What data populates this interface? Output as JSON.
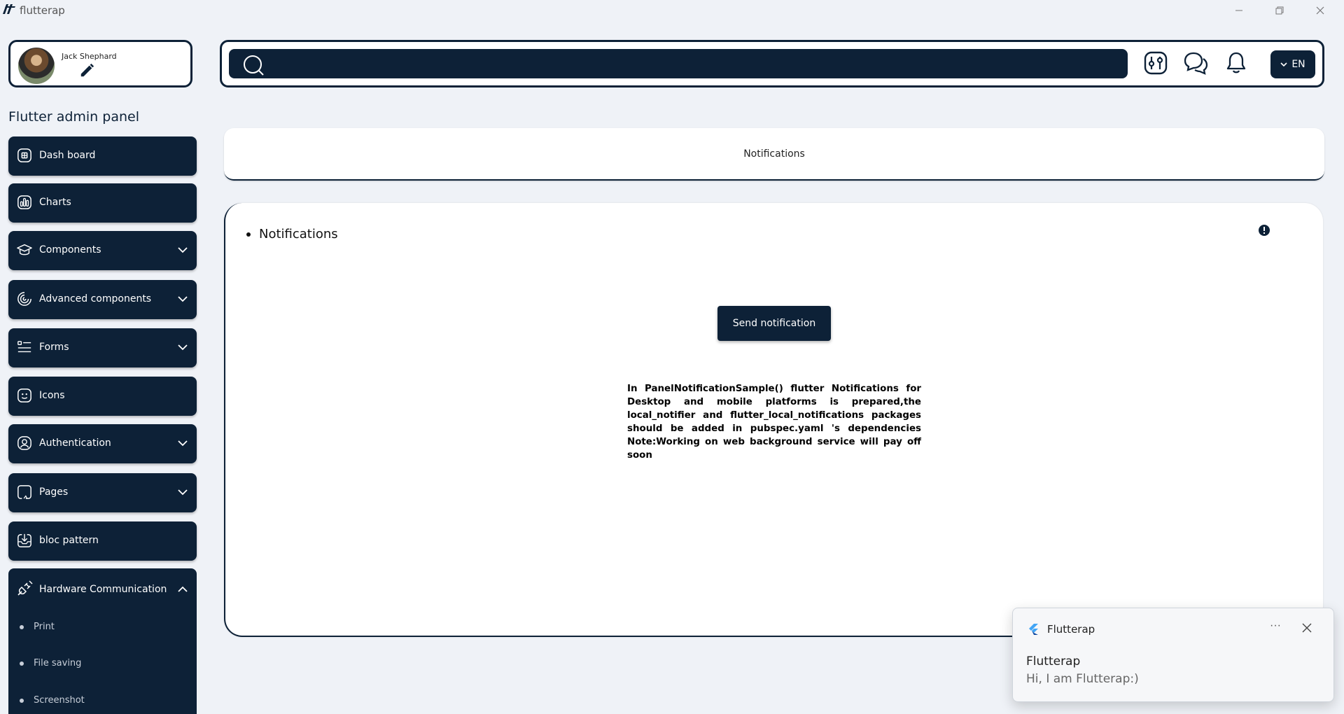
{
  "window": {
    "title": "flutterap"
  },
  "profile": {
    "name": "Jack Shephard"
  },
  "sidebar": {
    "panel_title": "Flutter admin panel",
    "items": [
      {
        "label": "Dash board",
        "icon": "dashboard-icon",
        "expandable": false
      },
      {
        "label": "Charts",
        "icon": "chart-icon",
        "expandable": false
      },
      {
        "label": "Components",
        "icon": "graduation-cap-icon",
        "expandable": true
      },
      {
        "label": "Advanced components",
        "icon": "spinner-icon",
        "expandable": true
      },
      {
        "label": "Forms",
        "icon": "form-list-icon",
        "expandable": true
      },
      {
        "label": "Icons",
        "icon": "smiley-icon",
        "expandable": false
      },
      {
        "label": "Authentication",
        "icon": "user-circle-icon",
        "expandable": true
      },
      {
        "label": "Pages",
        "icon": "pages-icon",
        "expandable": true
      },
      {
        "label": "bloc pattern",
        "icon": "inbox-download-icon",
        "expandable": false
      }
    ],
    "hardware": {
      "label": "Hardware Communication",
      "icon": "plug-icon",
      "expanded": true,
      "subitems": [
        "Print",
        "File saving",
        "Screenshot"
      ]
    }
  },
  "topbar": {
    "search_placeholder": "",
    "language": "EN"
  },
  "header": {
    "title": "Notifications"
  },
  "main": {
    "section_title": "Notifications",
    "button_label": "Send notification",
    "description": "In PanelNotificationSample() flutter Notifications for Desktop and mobile platforms is prepared,the local_notifier and flutter_local_notifications packages should be added in pubspec.yaml 's dependencies Note:Working on web background service will pay off soon"
  },
  "toast": {
    "app_name": "Flutterap",
    "more": "···",
    "title": "Flutterap",
    "body": "Hi, I am Flutterap:)"
  },
  "colors": {
    "primary": "#0d2137",
    "background": "#eff2f7",
    "card": "#ffffff"
  }
}
